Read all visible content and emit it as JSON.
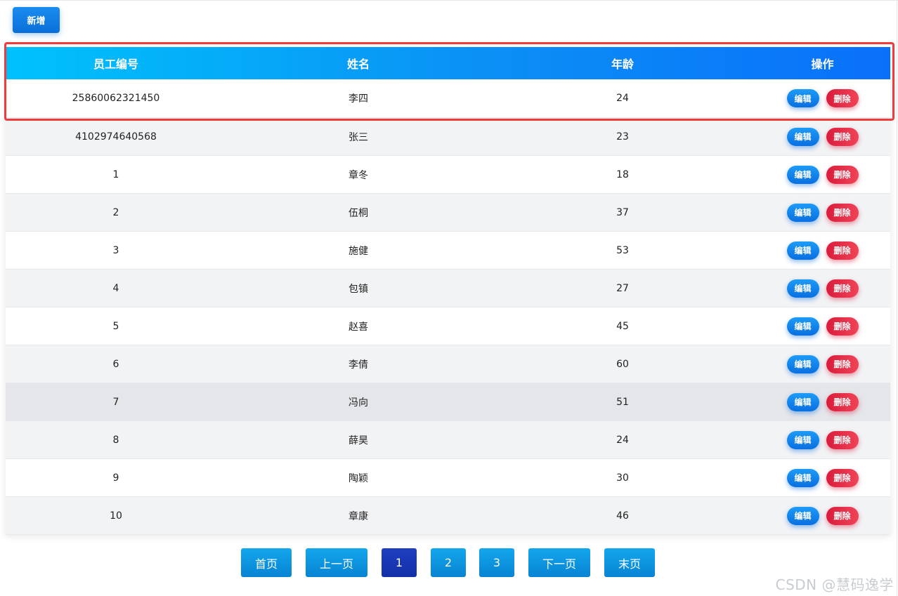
{
  "toolbar": {
    "add_label": "新增"
  },
  "table": {
    "headers": [
      "员工编号",
      "姓名",
      "年龄",
      "操作"
    ],
    "edit_label": "编辑",
    "delete_label": "删除",
    "rows": [
      {
        "id": "25860062321450",
        "name": "李四",
        "age": "24"
      },
      {
        "id": "4102974640568",
        "name": "张三",
        "age": "23"
      },
      {
        "id": "1",
        "name": "章冬",
        "age": "18"
      },
      {
        "id": "2",
        "name": "伍桐",
        "age": "37"
      },
      {
        "id": "3",
        "name": "施健",
        "age": "53"
      },
      {
        "id": "4",
        "name": "包镇",
        "age": "27"
      },
      {
        "id": "5",
        "name": "赵喜",
        "age": "45"
      },
      {
        "id": "6",
        "name": "李倩",
        "age": "60"
      },
      {
        "id": "7",
        "name": "冯向",
        "age": "51"
      },
      {
        "id": "8",
        "name": "薛昊",
        "age": "24"
      },
      {
        "id": "9",
        "name": "陶颖",
        "age": "30"
      },
      {
        "id": "10",
        "name": "章康",
        "age": "46"
      }
    ]
  },
  "pagination": {
    "first": "首页",
    "prev": "上一页",
    "pages": [
      "1",
      "2",
      "3"
    ],
    "current_page": "1",
    "next": "下一页",
    "last": "末页"
  },
  "watermark": "CSDN @慧码逸学",
  "colors": {
    "header_gradient_start": "#00c2fb",
    "header_gradient_end": "#0a70fa",
    "edit_button": "#0a6fe0",
    "delete_button": "#e02a46",
    "highlight_border": "#ef3b3b",
    "current_page": "#1f3fc0"
  }
}
